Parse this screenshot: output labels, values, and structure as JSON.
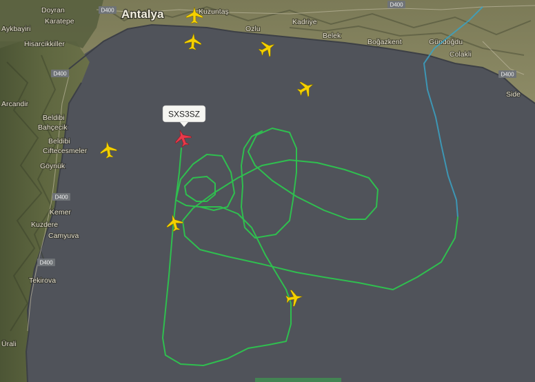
{
  "map": {
    "city_label": "Antalya",
    "places": [
      "Doyran",
      "Karatepe",
      "Aykbayiri",
      "Hisarcikkiller",
      "Arcandir",
      "Beldibi",
      "Bahçecik",
      "Beldibi",
      "Ciftecesmeler",
      "Göynük",
      "Kemer",
      "Kuzdere",
      "Camyuva",
      "Tekirova",
      "Ürali",
      "Kuzuntaş",
      "Ozlu",
      "Kadriye",
      "Belek",
      "Boğazkent",
      "Gündoğdu",
      "Colakli",
      "Side"
    ],
    "road_shields": [
      "D400",
      "D400",
      "D400",
      "D400",
      "D400",
      "D400"
    ]
  },
  "flight": {
    "callsign": "SXS3SZ",
    "track_color": "#2fbf4f",
    "selected_color": "#e8394a",
    "other_aircraft_color": "#f5d000"
  },
  "other_aircraft_count": 7
}
